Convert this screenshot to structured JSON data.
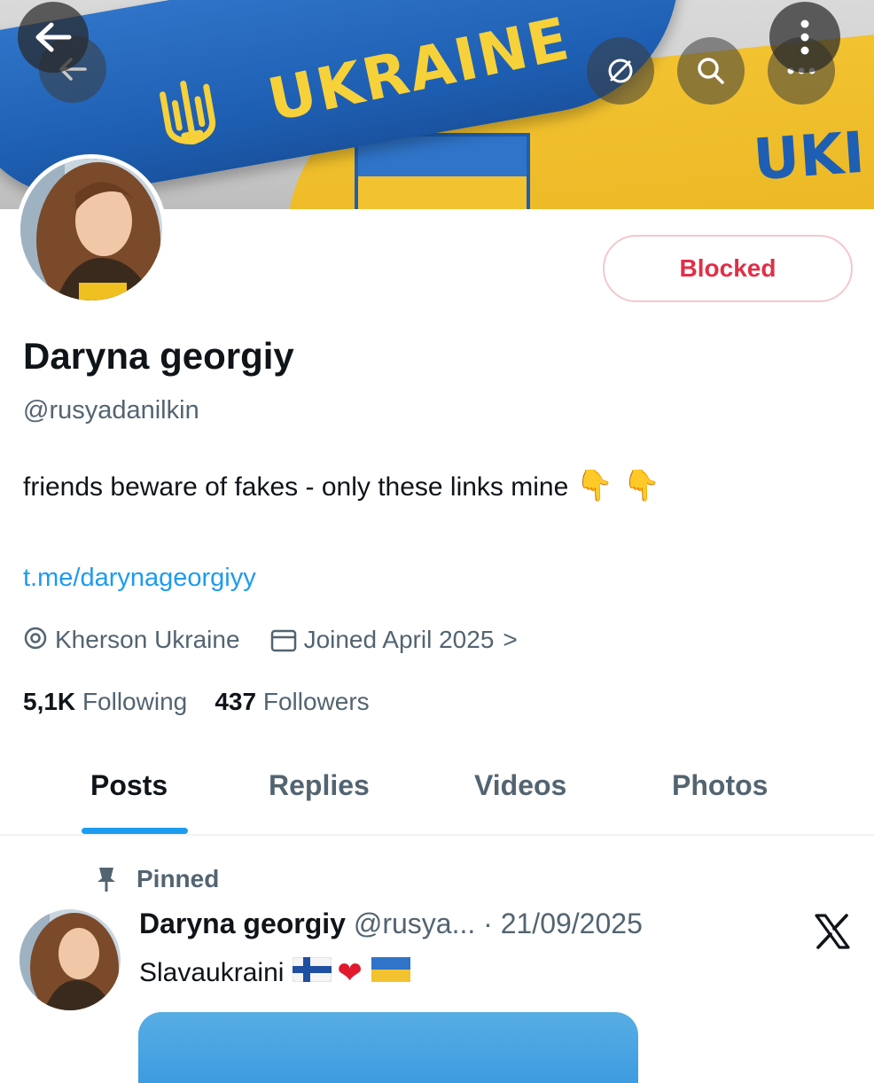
{
  "banner": {
    "text_main": "UKRAINE",
    "text_secondary": "UKI",
    "back_icon": "arrow-left-icon",
    "more_icon": "more-vertical-icon",
    "grok_icon": "grok-icon",
    "search_icon": "search-icon",
    "overflow_icon": "more-horizontal-icon"
  },
  "profile": {
    "display_name": "Daryna georgiy",
    "handle": "@rusyadanilkin",
    "bio": "friends beware of fakes - only these links mine",
    "bio_emoji": "👇 👇",
    "link": "t.me/darynageorgiyy",
    "location": "Kherson Ukraine",
    "joined": "Joined April 2025",
    "joined_chevron": ">",
    "following_count": "5,1K",
    "following_label": "Following",
    "followers_count": "437",
    "followers_label": "Followers",
    "blocked_label": "Blocked"
  },
  "tabs": [
    {
      "label": "Posts",
      "active": true
    },
    {
      "label": "Replies",
      "active": false
    },
    {
      "label": "Videos",
      "active": false
    },
    {
      "label": "Photos",
      "active": false
    }
  ],
  "post": {
    "pinned_label": "Pinned",
    "author_name": "Daryna georgiy",
    "author_handle": "@rusya...",
    "separator": "·",
    "date": "21/09/2025",
    "text": "Slavaukraini",
    "text_emoji_heart": "❤"
  },
  "colors": {
    "accent": "#1d9bf0",
    "blocked_red": "#e02f47",
    "muted": "#536471",
    "ukraine_blue": "#1e5fb3",
    "ukraine_yellow": "#f2c230"
  }
}
